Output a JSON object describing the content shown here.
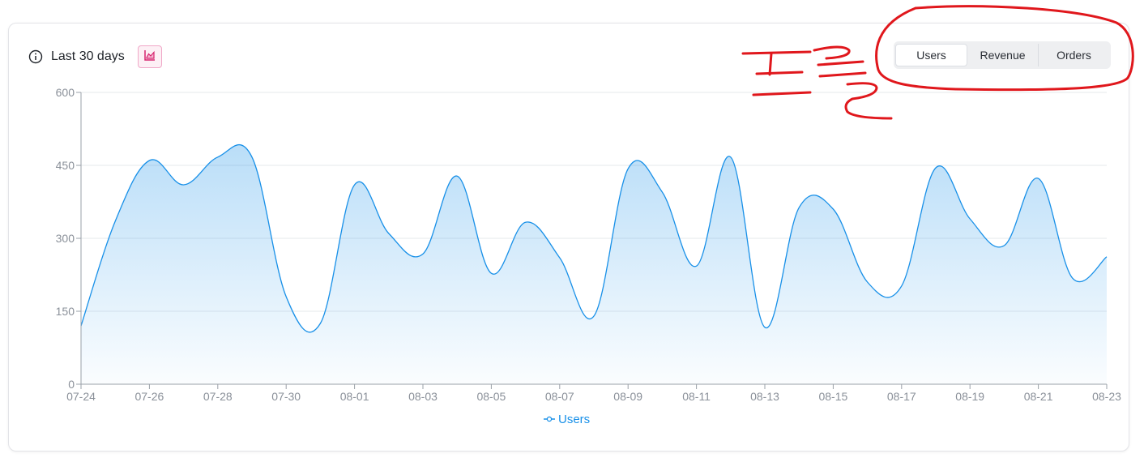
{
  "header": {
    "title": "Last 30 days",
    "info_icon": "info-circle-icon",
    "chart_type_icon": "area-chart-icon"
  },
  "segmented": {
    "items": [
      "Users",
      "Revenue",
      "Orders"
    ],
    "selected": "Users"
  },
  "colors": {
    "accent": "#1890e8",
    "chart_icon": "#d6246e",
    "annotation": "#e0171c"
  },
  "chart_data": {
    "type": "area",
    "ylim": [
      0,
      600
    ],
    "yticks": [
      0,
      150,
      300,
      450,
      600
    ],
    "x": [
      "07-24",
      "07-25",
      "07-26",
      "07-27",
      "07-28",
      "07-29",
      "07-30",
      "07-31",
      "08-01",
      "08-02",
      "08-03",
      "08-04",
      "08-05",
      "08-06",
      "08-07",
      "08-08",
      "08-09",
      "08-10",
      "08-11",
      "08-12",
      "08-13",
      "08-14",
      "08-15",
      "08-16",
      "08-17",
      "08-18",
      "08-19",
      "08-20",
      "08-21",
      "08-22",
      "08-23"
    ],
    "xtick_labels": [
      "07-24",
      "07-26",
      "07-28",
      "07-30",
      "08-01",
      "08-03",
      "08-05",
      "08-07",
      "08-09",
      "08-11",
      "08-13",
      "08-15",
      "08-17",
      "08-19",
      "08-21",
      "08-23"
    ],
    "series": [
      {
        "name": "Users",
        "values": [
          120,
          335,
          460,
          410,
          467,
          467,
          180,
          125,
          410,
          310,
          268,
          428,
          228,
          333,
          260,
          140,
          443,
          395,
          243,
          467,
          117,
          363,
          360,
          210,
          202,
          445,
          340,
          285,
          423,
          218,
          262
        ]
      }
    ],
    "legend": "bottom-center",
    "grid": true
  }
}
